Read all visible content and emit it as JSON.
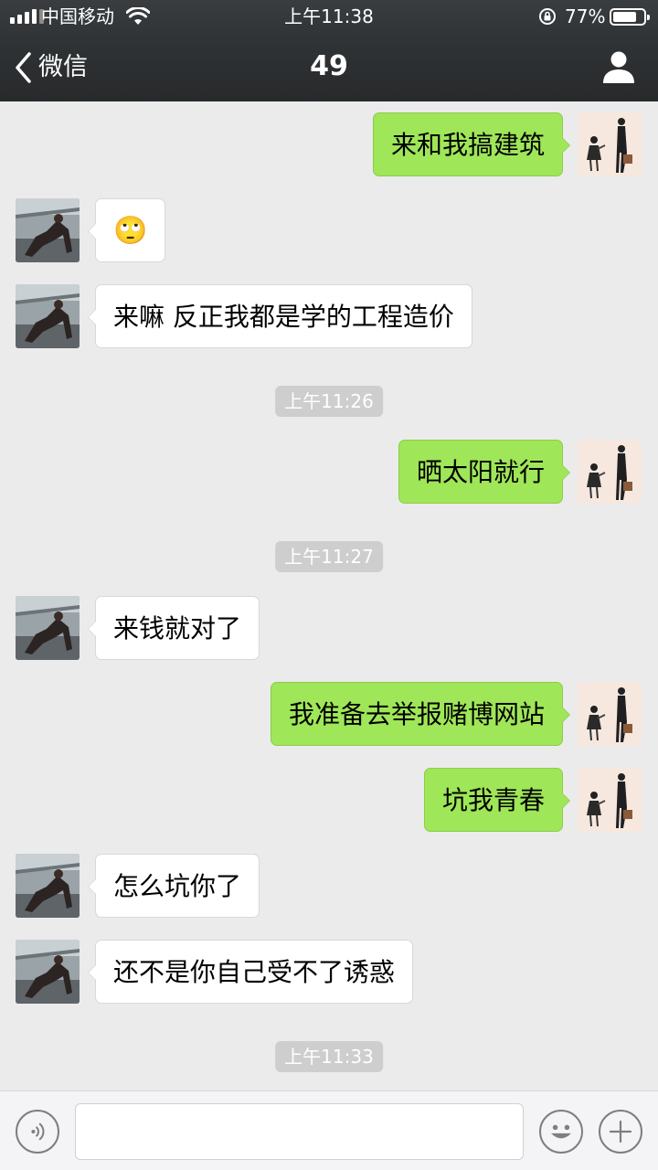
{
  "status_bar": {
    "carrier": "中国移动",
    "time": "上午11:38",
    "battery_percent": "77%",
    "battery_level": 0.77,
    "icons": [
      "signal-icon",
      "wifi-icon",
      "rotation-lock-icon",
      "battery-icon"
    ]
  },
  "nav": {
    "back_label": "微信",
    "title": "49",
    "icons": [
      "chevron-left-icon",
      "person-icon"
    ]
  },
  "messages": [
    {
      "type": "text",
      "from": "me",
      "text": "来和我搞建筑"
    },
    {
      "type": "emoji",
      "from": "other",
      "emoji": "🙄"
    },
    {
      "type": "text",
      "from": "other",
      "text": "来嘛 反正我都是学的工程造价"
    },
    {
      "type": "time",
      "text": "上午11:26"
    },
    {
      "type": "text",
      "from": "me",
      "text": "晒太阳就行"
    },
    {
      "type": "time",
      "text": "上午11:27"
    },
    {
      "type": "text",
      "from": "other",
      "text": "来钱就对了"
    },
    {
      "type": "text",
      "from": "me",
      "text": "我准备去举报赌博网站"
    },
    {
      "type": "text",
      "from": "me",
      "text": "坑我青春"
    },
    {
      "type": "text",
      "from": "other",
      "text": "怎么坑你了"
    },
    {
      "type": "text",
      "from": "other",
      "text": "还不是你自己受不了诱惑"
    },
    {
      "type": "time",
      "text": "上午11:33"
    }
  ],
  "input_bar": {
    "value": "",
    "placeholder": "",
    "icons": [
      "voice-icon",
      "emoji-icon",
      "plus-icon"
    ]
  },
  "colors": {
    "nav_bg": "#2f3234",
    "chat_bg": "#ebebeb",
    "my_bubble": "#9fe658",
    "other_bubble": "#ffffff",
    "timestamp_bg": "#cecece"
  }
}
